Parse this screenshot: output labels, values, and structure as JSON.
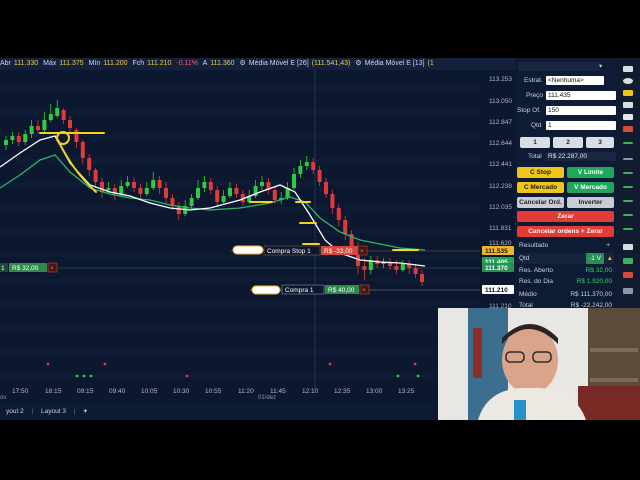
{
  "quote_bar": {
    "open_label": "Abr",
    "open_value": "111.330",
    "max_label": "Máx",
    "max_value": "111.375",
    "min_label": "Mín",
    "min_value": "111.200",
    "close_label": "Fch",
    "close_value": "111.210",
    "change": "-0.11%",
    "a_label": "A",
    "a_value": "111.360",
    "ma1": "Média Móvel E [26]",
    "ma1_value": "(111.541,43)",
    "ma2": "Média Móvel E [13]",
    "ma2_value": "(1"
  },
  "price_axis": [
    "113.253",
    "113.050",
    "112.847",
    "112.644",
    "112.441",
    "112.238",
    "112.035",
    "111.831",
    "111.620",
    "111.210"
  ],
  "price_tags": {
    "stop": "111.535",
    "last": "111.405",
    "current": "111.370",
    "buy": "111.210"
  },
  "orders": {
    "left_position": "1",
    "left_value": "R$ 32,00",
    "left_close": "×",
    "stop_label": "Compra Stop 1",
    "stop_value": "R$ -33,00",
    "stop_close": "×",
    "buy_label": "Compra 1",
    "buy_value": "R$ 40,00",
    "buy_close": "×"
  },
  "time_axis": [
    "17:50",
    "18:15",
    "09:15",
    "09:40",
    "10:05",
    "10:30",
    "10:55",
    "11:20",
    "11:45",
    "12:10",
    "12:35",
    "13:00",
    "13:25"
  ],
  "date_label": "01/dez",
  "bottom_tabs": {
    "left_partial": "yout 2",
    "layout3": "Layout 3",
    "add": "+",
    "nov": "ov"
  },
  "boleta": {
    "strategy_label": "Estrat.",
    "strategy_value": "<Nenhuma>",
    "price_label": "Preço",
    "price_value": "111.435",
    "stop_label": "Stop Of.",
    "stop_value": "150",
    "qty_label": "Qtd",
    "qty_value": "1",
    "quick_qty": [
      "1",
      "2",
      "3"
    ],
    "total_label": "Total",
    "total_value": "R$ 22.287,00",
    "c_stop": "C Stop",
    "v_limite": "V Limite",
    "c_mercado": "C Mercado",
    "v_mercado": "V Mercado",
    "cancel": "Cancelar Ord.",
    "invert": "Inverter",
    "zerar": "Zerar",
    "cancel_zerar": "Cancelar ordens + Zerar"
  },
  "result": {
    "title": "Resultado",
    "qtd_label": "Qtd",
    "qtd_value": "-1 V",
    "open_label": "Res. Aberto",
    "open_value": "R$ 32,00",
    "day_label": "Res. do Dia",
    "day_value": "R$ 1.920,00",
    "avg_label": "Médio",
    "avg_value": "R$ 111.370,00",
    "total_label": "Total",
    "total_value": "R$ -22.242,00"
  },
  "colors": {
    "background": "#0c1830",
    "bull": "#2ecc40",
    "bear": "#e23a3a",
    "ma_fast": "#ffffff",
    "ma_slow": "#25b864",
    "annotation": "#f5d31b"
  }
}
